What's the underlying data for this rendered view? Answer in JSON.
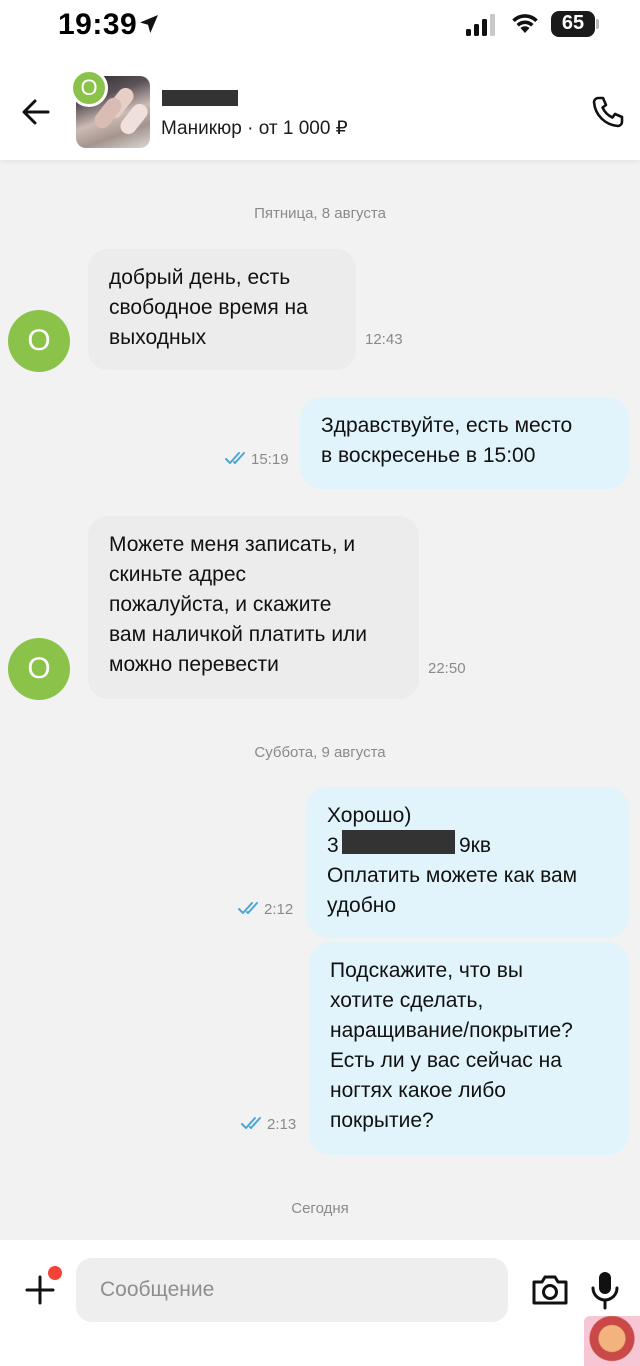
{
  "status_bar": {
    "time": "19:39",
    "battery": "65"
  },
  "header": {
    "avatar_letter": "O",
    "listing_subtitle": "Маникюр · от 1 000 ₽"
  },
  "chat": {
    "date_1": "Пятница, 8 августа",
    "date_2": "Суббота, 9 августа",
    "date_3": "Сегодня",
    "messages": [
      {
        "sender": "O",
        "text": "добрый день, есть\nсвободное время на\nвыходных",
        "time": "12:43"
      },
      {
        "text": "Здравствуйте, есть место\nв воскресенье в 15:00",
        "time": "15:19"
      },
      {
        "sender": "O",
        "text": "Можете меня записать, и\nскиньте адрес\nпожалуйста, и скажите\nвам наличкой платить или\nможно перевести",
        "time": "22:50"
      },
      {
        "line1": "Хорошо)",
        "line2_start": "3",
        "line2_end": "9кв",
        "line3": "Оплатить можете как вам\nудобно",
        "time": "2:12"
      },
      {
        "text": "Подскажите, что вы\nхотите сделать,\nнаращивание/покрытие?\nЕсть ли у вас сейчас на\nногтях какое либо\nпокрытие?",
        "time": "2:13"
      }
    ]
  },
  "composer": {
    "placeholder": "Сообщение"
  },
  "colors": {
    "avatar_green": "#8bc34a",
    "outgoing_bubble": "#e1f3fb",
    "incoming_bubble": "#ececec",
    "read_checks": "#4aa7d6",
    "notification_dot": "#f44336"
  },
  "icons": [
    "location-arrow-icon",
    "signal-icon",
    "wifi-icon",
    "battery-icon",
    "back-arrow-icon",
    "phone-icon",
    "double-check-icon",
    "plus-icon",
    "camera-icon",
    "microphone-icon"
  ]
}
